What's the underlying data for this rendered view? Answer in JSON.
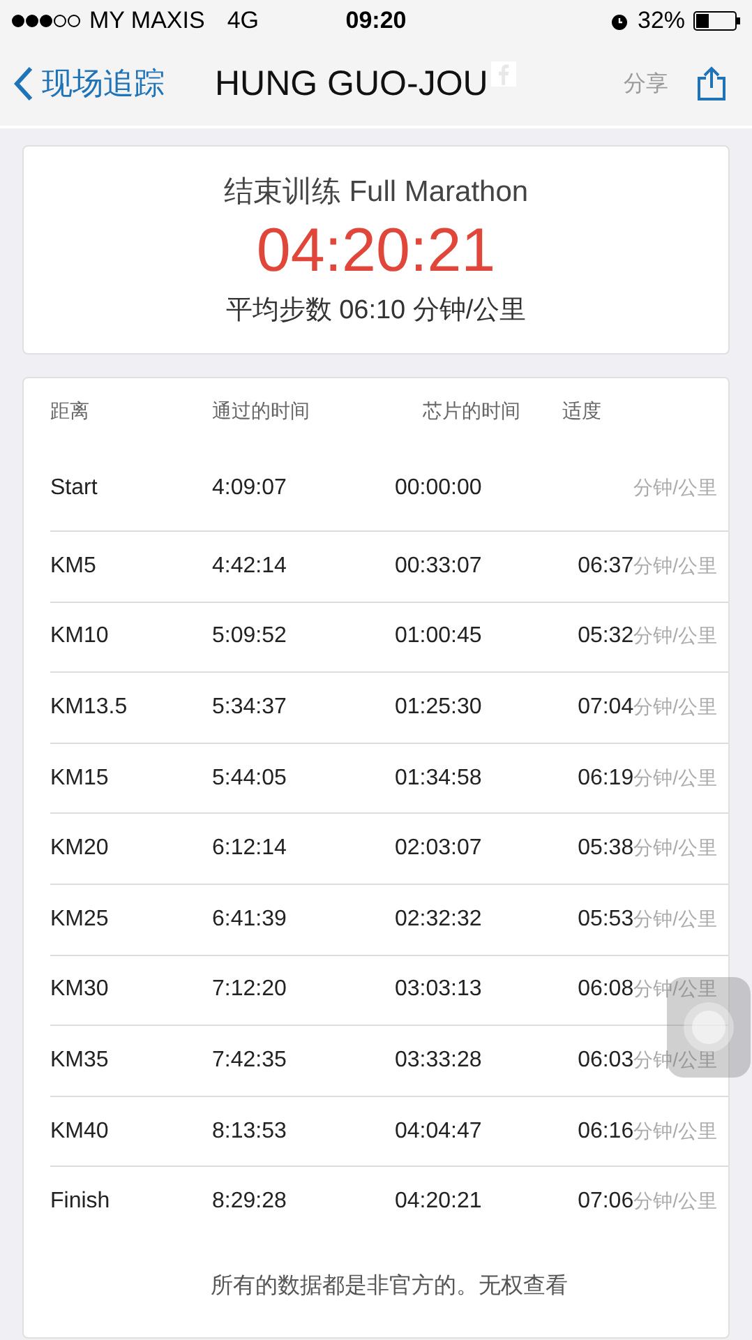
{
  "status_bar": {
    "carrier": "MY MAXIS",
    "network": "4G",
    "time": "09:20",
    "battery": "32%"
  },
  "nav": {
    "back": "现场追踪",
    "title": "HUNG GUO-JOU",
    "share_label": "分享"
  },
  "summary": {
    "title": "结束训练 Full Marathon",
    "time": "04:20:21",
    "pace": "平均步数 06:10 分钟/公里"
  },
  "table": {
    "columns": [
      "距离",
      "通过的时间",
      "芯片的时间",
      "适度"
    ],
    "rows": [
      {
        "distance": "Start",
        "pass_time": "4:09:07",
        "chip_time": "00:00:00",
        "unit": "分钟/公里"
      },
      {
        "distance": "KM5",
        "pass_time": "4:42:14",
        "chip_time": "00:33:07",
        "pace": "06:37",
        "unit": "分钟/公里"
      },
      {
        "distance": "KM10",
        "pass_time": "5:09:52",
        "chip_time": "01:00:45",
        "pace": "05:32",
        "unit": "分钟/公里"
      },
      {
        "distance": "KM13.5",
        "pass_time": "5:34:37",
        "chip_time": "01:25:30",
        "pace": "07:04",
        "unit": "分钟/公里"
      },
      {
        "distance": "KM15",
        "pass_time": "5:44:05",
        "chip_time": "01:34:58",
        "pace": "06:19",
        "unit": "分钟/公里"
      },
      {
        "distance": "KM20",
        "pass_time": "6:12:14",
        "chip_time": "02:03:07",
        "pace": "05:38",
        "unit": "分钟/公里"
      },
      {
        "distance": "KM25",
        "pass_time": "6:41:39",
        "chip_time": "02:32:32",
        "pace": "05:53",
        "unit": "分钟/公里"
      },
      {
        "distance": "KM30",
        "pass_time": "7:12:20",
        "chip_time": "03:03:13",
        "pace": "06:08",
        "unit": "分钟/公里"
      },
      {
        "distance": "KM35",
        "pass_time": "7:42:35",
        "chip_time": "03:33:28",
        "pace": "06:03",
        "unit": "分钟/公里"
      },
      {
        "distance": "KM40",
        "pass_time": "8:13:53",
        "chip_time": "04:04:47",
        "pace": "06:16",
        "unit": "分钟/公里"
      },
      {
        "distance": "Finish",
        "pass_time": "8:29:28",
        "chip_time": "04:20:21",
        "pace": "07:06",
        "unit": "分钟/公里"
      }
    ],
    "footer": "所有的数据都是非官方的。无权查看"
  }
}
